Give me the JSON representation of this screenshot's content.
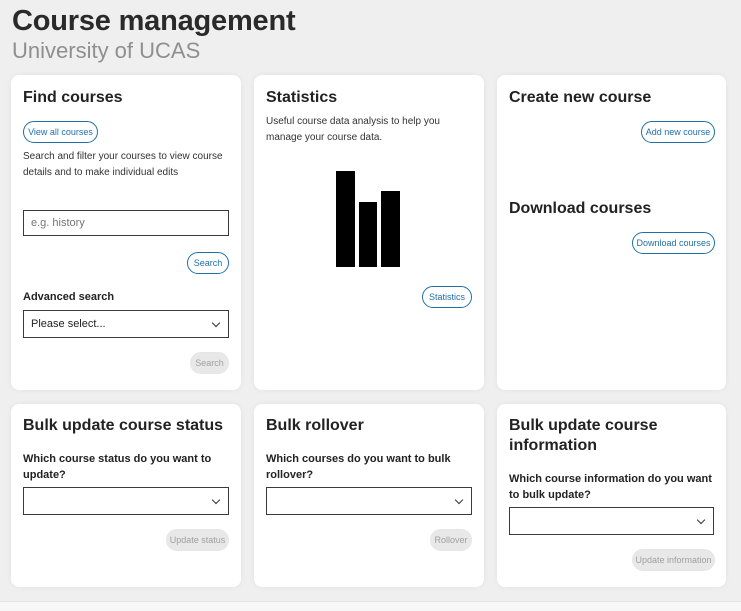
{
  "header": {
    "title": "Course management",
    "subtitle": "University of UCAS"
  },
  "find_courses": {
    "heading": "Find courses",
    "view_all_label": "View all courses",
    "description": "Search and filter your courses to view course details and to make individual edits",
    "search_placeholder": "e.g. history",
    "search_label": "Search",
    "advanced_label": "Advanced search",
    "advanced_selected": "Please select...",
    "advanced_search_label": "Search"
  },
  "statistics": {
    "heading": "Statistics",
    "description": "Useful course data analysis to help you manage your course data.",
    "icon": "bar-chart-icon",
    "button_label": "Statistics"
  },
  "create_course": {
    "heading": "Create new course",
    "button_label": "Add new course"
  },
  "download_courses": {
    "heading": "Download courses",
    "button_label": "Download courses"
  },
  "bulk_status": {
    "heading": "Bulk update course status",
    "question": "Which course status do you want to update?",
    "selected": "",
    "button_label": "Update status"
  },
  "bulk_rollover": {
    "heading": "Bulk rollover",
    "question": "Which courses do you want to bulk rollover?",
    "selected": "",
    "button_label": "Rollover"
  },
  "bulk_info": {
    "heading": "Bulk update course information",
    "question": "Which course information do you want to bulk update?",
    "selected": "",
    "button_label": "Update information"
  },
  "colors": {
    "accent": "#1f6fa8",
    "background": "#efefef",
    "disabled": "#e8e8e8"
  }
}
